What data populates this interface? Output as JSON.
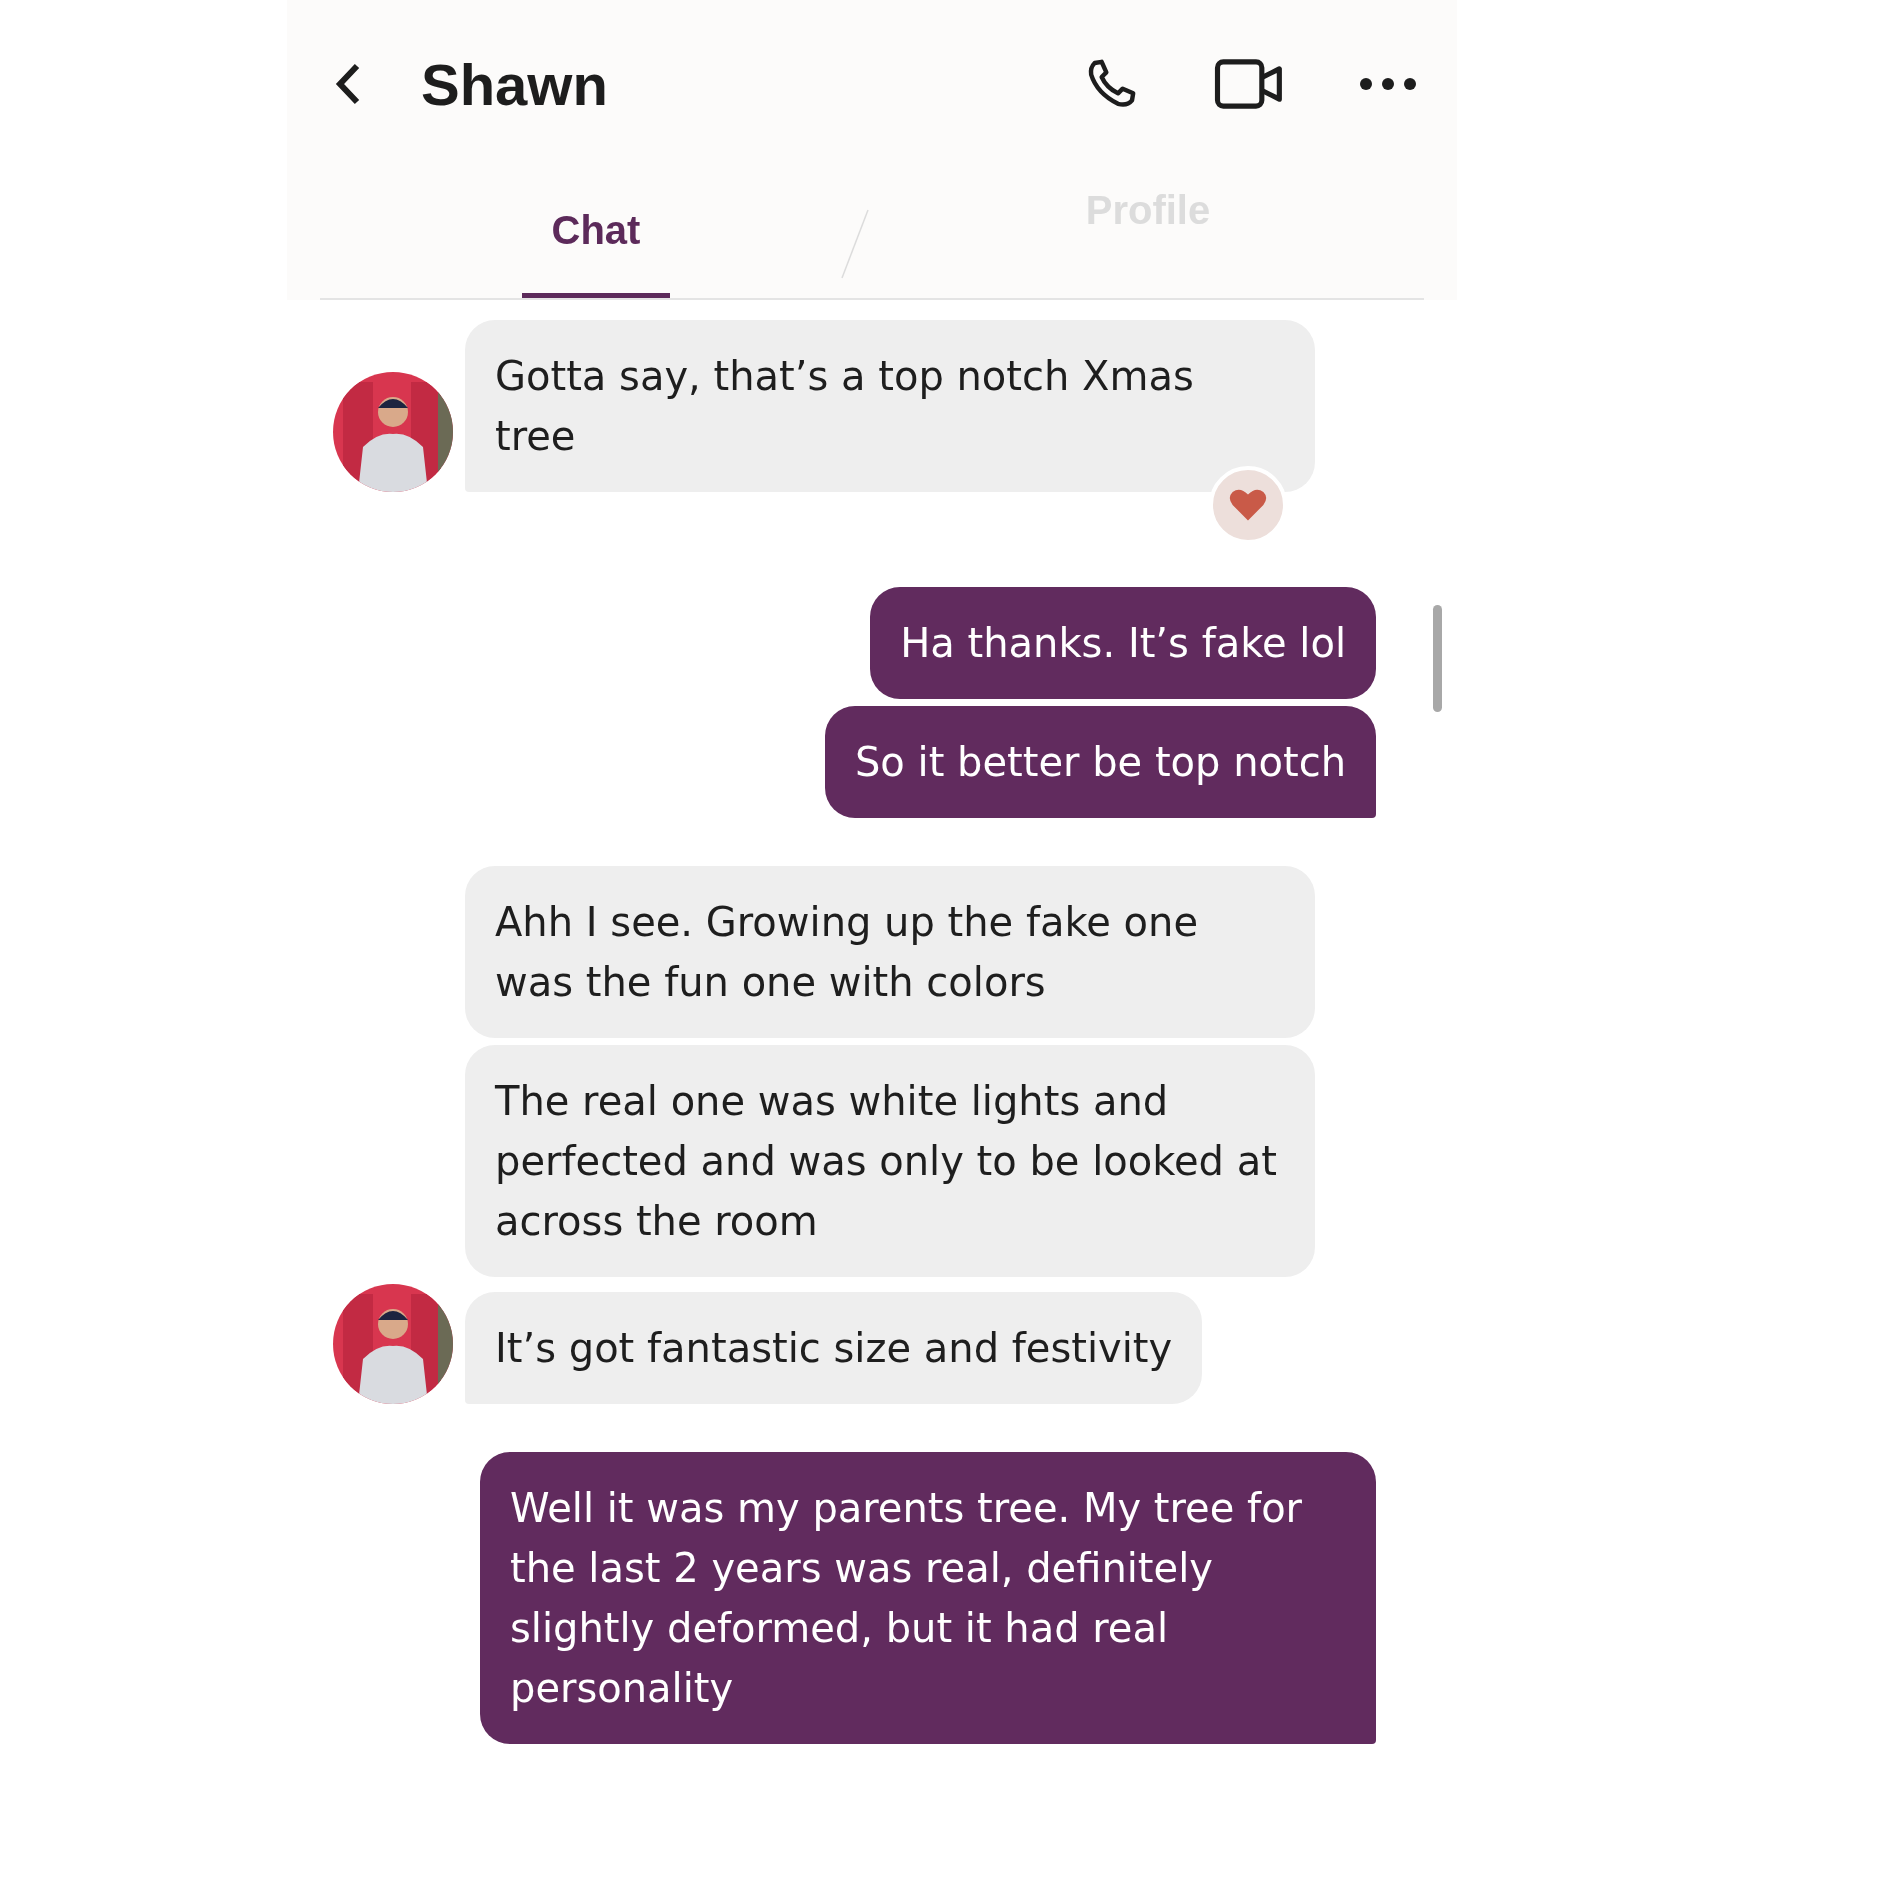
{
  "header": {
    "title": "Shawn"
  },
  "tabs": [
    {
      "label": "Chat",
      "selected": true
    },
    {
      "label": "Profile",
      "selected": false
    }
  ],
  "messages": [
    {
      "kind": "received",
      "text": "Gotta say, that’s a top notch Xmas tree",
      "avatar": true,
      "hearted": true
    },
    {
      "kind": "sent",
      "text": "Ha thanks. It’s fake lol"
    },
    {
      "kind": "sent",
      "text": "So it better be top notch"
    },
    {
      "kind": "received",
      "text": "Ahh I see. Growing up the fake one was the fun one with colors",
      "avatar": false,
      "hearted": false
    },
    {
      "kind": "received",
      "text": "The real one was white lights and perfected and was only to be looked at across the room",
      "avatar": false,
      "hearted": false
    },
    {
      "kind": "received",
      "text": "It’s got fantastic size and festivity",
      "avatar": true,
      "hearted": false
    },
    {
      "kind": "sent",
      "text": "Well it was my parents tree. My tree for the last 2 years was real, definitely slightly deformed, but it had real personality"
    }
  ]
}
